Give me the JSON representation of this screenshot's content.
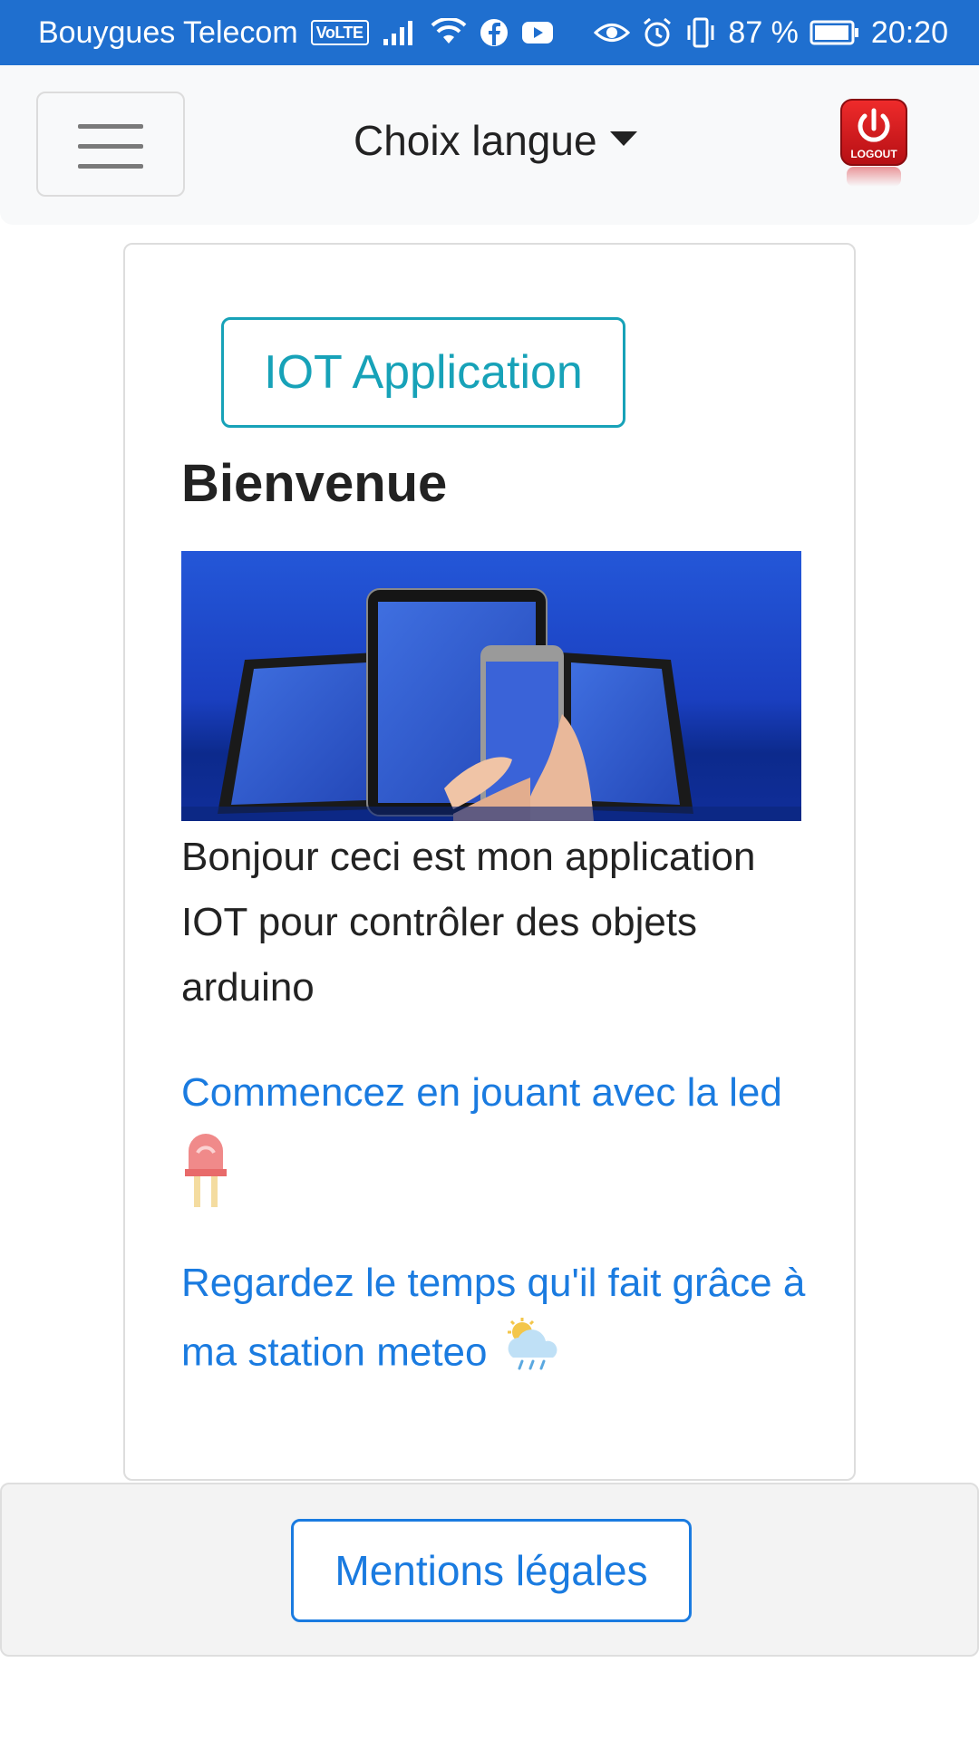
{
  "status_bar": {
    "carrier": "Bouygues Telecom",
    "volte_badge": "VoLTE",
    "battery_percent": "87 %",
    "time": "20:20",
    "icons_left": [
      "volte-icon",
      "signal-icon",
      "wifi-icon",
      "facebook-icon",
      "youtube-icon"
    ],
    "icons_right": [
      "eye-icon",
      "alarm-icon",
      "vibrate-icon",
      "battery-icon"
    ]
  },
  "navbar": {
    "menu_icon": "hamburger-icon",
    "language_toggle": "Choix langue",
    "logout_label": "LOGOUT",
    "logout_color": "#d71920"
  },
  "card": {
    "app_button_label": "IOT Application",
    "heading": "Bienvenue",
    "intro_text": "Bonjour ceci est mon application IOT pour contrôler des objets arduino",
    "led_link_text": "Commencez en jouant avec la led",
    "meteo_link_text": "Regardez le temps qu'il fait grâce à ma station meteo"
  },
  "footer": {
    "legal_button_label": "Mentions légales"
  },
  "colors": {
    "status_bar": "#1f6fcf",
    "accent_info": "#17a2b8",
    "link": "#1a7be0",
    "navbar_bg": "#f8f9fa"
  }
}
